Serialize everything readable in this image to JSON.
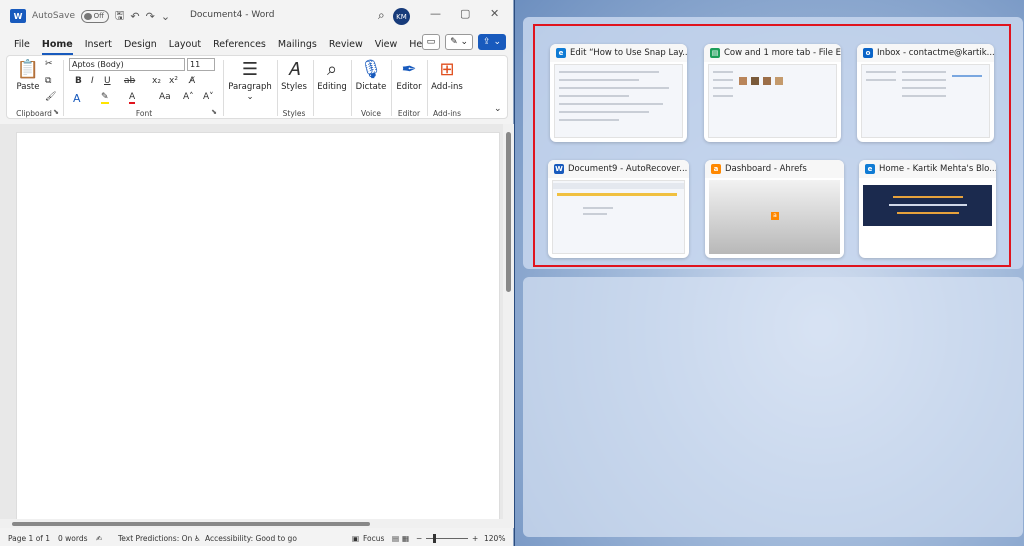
{
  "word": {
    "titlebar": {
      "autosave_label": "AutoSave",
      "autosave_state": "Off",
      "document_title": "Document4  -  Word",
      "avatar_initials": "KM"
    },
    "menu": [
      "File",
      "Home",
      "Insert",
      "Design",
      "Layout",
      "References",
      "Mailings",
      "Review",
      "View",
      "Help"
    ],
    "active_menu": "Home",
    "ribbon": {
      "paste_label": "Paste",
      "clipboard_label": "Clipboard",
      "font_name": "Aptos (Body)",
      "font_size": "11",
      "font_label": "Font",
      "paragraph_label": "Paragraph",
      "styles_button": "Styles",
      "styles_label": "Styles",
      "editing_label": "Editing",
      "dictate_label": "Dictate",
      "voice_label": "Voice",
      "editor_button": "Editor",
      "editor_label": "Editor",
      "addins_button": "Add-ins",
      "addins_label": "Add-ins"
    },
    "status": {
      "page": "Page 1 of 1",
      "words": "0 words",
      "text_predictions": "Text Predictions: On",
      "accessibility": "Accessibility: Good to go",
      "focus": "Focus",
      "zoom": "120%"
    }
  },
  "snap": {
    "windows": [
      {
        "title": "Edit “How to Use Snap Lay...",
        "app": "edge",
        "color": "#0f7bd4"
      },
      {
        "title": "Cow and 1 more tab - File E...",
        "app": "explorer",
        "color": "#1e9e5a"
      },
      {
        "title": "Inbox - contactme@kartik...",
        "app": "outlook",
        "color": "#0a64c8"
      },
      {
        "title": "Document9  -  AutoRecover...",
        "app": "word",
        "color": "#185abd"
      },
      {
        "title": "Dashboard - Ahrefs",
        "app": "ahrefs",
        "color": "#ff8800"
      },
      {
        "title": "Home - Kartik Mehta's Blo...",
        "app": "edge",
        "color": "#0f7bd4"
      }
    ],
    "highlight_color": "#e0141e"
  }
}
